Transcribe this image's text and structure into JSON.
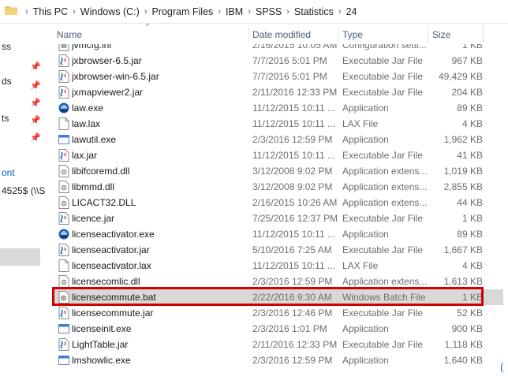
{
  "address": {
    "crumbs": [
      "This PC",
      "Windows (C:)",
      "Program Files",
      "IBM",
      "SPSS",
      "Statistics",
      "24"
    ]
  },
  "sidebar": {
    "fragments": [
      "ss",
      "ds",
      "ts",
      "ont",
      "4525$ (\\\\S"
    ]
  },
  "columns": {
    "name": "Name",
    "date": "Date modified",
    "type": "Type",
    "size": "Size"
  },
  "files": [
    {
      "name": "jvmcfg.ini",
      "date": "2/16/2015 10:05 AM",
      "type": "Configuration setti...",
      "size": "1 KB",
      "icon": "settings-file-icon"
    },
    {
      "name": "jxbrowser-6.5.jar",
      "date": "7/7/2016 5:01 PM",
      "type": "Executable Jar File",
      "size": "967 KB",
      "icon": "jar-file-icon"
    },
    {
      "name": "jxbrowser-win-6.5.jar",
      "date": "7/7/2016 5:01 PM",
      "type": "Executable Jar File",
      "size": "49,429 KB",
      "icon": "jar-file-icon"
    },
    {
      "name": "jxmapviewer2.jar",
      "date": "2/11/2016 12:33 PM",
      "type": "Executable Jar File",
      "size": "204 KB",
      "icon": "jar-file-icon"
    },
    {
      "name": "law.exe",
      "date": "11/12/2015 10:11 ...",
      "type": "Application",
      "size": "89 KB",
      "icon": "install-app-icon"
    },
    {
      "name": "law.lax",
      "date": "11/12/2015 10:11 ...",
      "type": "LAX File",
      "size": "4 KB",
      "icon": "blank-file-icon"
    },
    {
      "name": "lawutil.exe",
      "date": "2/3/2016 12:59 PM",
      "type": "Application",
      "size": "1,962 KB",
      "icon": "app-window-icon"
    },
    {
      "name": "lax.jar",
      "date": "11/12/2015 10:11 ...",
      "type": "Executable Jar File",
      "size": "41 KB",
      "icon": "jar-file-icon"
    },
    {
      "name": "libifcoremd.dll",
      "date": "3/12/2008 9:02 PM",
      "type": "Application extens...",
      "size": "1,019 KB",
      "icon": "dll-file-icon"
    },
    {
      "name": "libmmd.dll",
      "date": "3/12/2008 9:02 PM",
      "type": "Application extens...",
      "size": "2,855 KB",
      "icon": "dll-file-icon"
    },
    {
      "name": "LICACT32.DLL",
      "date": "2/16/2015 10:26 AM",
      "type": "Application extens...",
      "size": "44 KB",
      "icon": "dll-file-icon"
    },
    {
      "name": "licence.jar",
      "date": "7/25/2016 12:37 PM",
      "type": "Executable Jar File",
      "size": "1 KB",
      "icon": "jar-file-icon"
    },
    {
      "name": "licenseactivator.exe",
      "date": "11/12/2015 10:11 ...",
      "type": "Application",
      "size": "89 KB",
      "icon": "install-app-icon"
    },
    {
      "name": "licenseactivator.jar",
      "date": "5/10/2016 7:25 AM",
      "type": "Executable Jar File",
      "size": "1,667 KB",
      "icon": "jar-file-icon"
    },
    {
      "name": "licenseactivator.lax",
      "date": "11/12/2015 10:11 ...",
      "type": "LAX File",
      "size": "4 KB",
      "icon": "blank-file-icon"
    },
    {
      "name": "licensecomlic.dll",
      "date": "2/3/2016 12:59 PM",
      "type": "Application extens...",
      "size": "1,613 KB",
      "icon": "dll-file-icon"
    },
    {
      "name": "licensecommute.bat",
      "date": "2/22/2016 9:30 AM",
      "type": "Windows Batch File",
      "size": "1 KB",
      "icon": "batch-file-icon",
      "selected": true
    },
    {
      "name": "licensecommute.jar",
      "date": "2/3/2016 12:46 PM",
      "type": "Executable Jar File",
      "size": "52 KB",
      "icon": "jar-file-icon"
    },
    {
      "name": "licenseinit.exe",
      "date": "2/3/2016 1:01 PM",
      "type": "Application",
      "size": "900 KB",
      "icon": "app-window-icon"
    },
    {
      "name": "LightTable.jar",
      "date": "2/11/2016 12:33 PM",
      "type": "Executable Jar File",
      "size": "1,118 KB",
      "icon": "jar-file-icon"
    },
    {
      "name": "lmshowlic.exe",
      "date": "2/3/2016 12:59 PM",
      "type": "Application",
      "size": "1,640 KB",
      "icon": "app-window-icon"
    }
  ],
  "colors": {
    "highlight": "#d40000",
    "selection": "#d9d9d9",
    "link": "#0066cc",
    "header_text": "#4c607a"
  }
}
